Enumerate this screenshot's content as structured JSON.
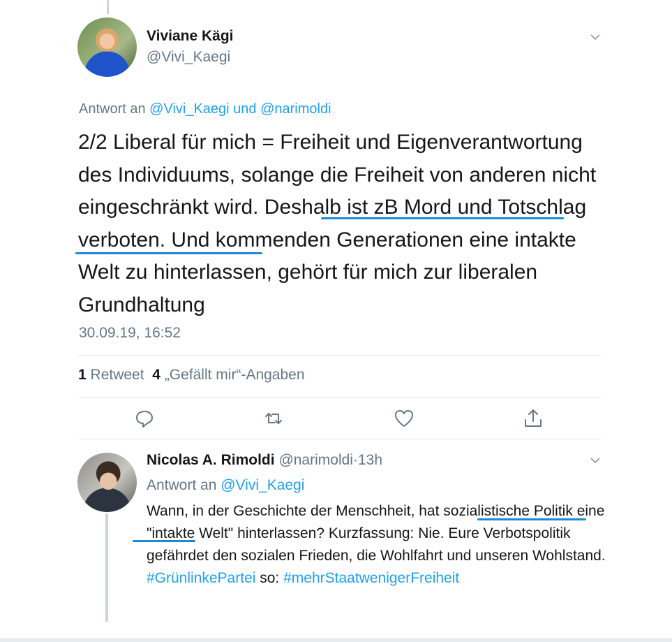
{
  "tweet": {
    "author_name": "Viviane Kägi",
    "author_handle": "@Vivi_Kaegi",
    "reply_prefix": "Antwort an ",
    "reply_handles": "@Vivi_Kaegi und @narimoldi",
    "text_before": "2/2 Liberal für mich = Freiheit und Eigenverantwortung des Individuums, solange die Freiheit von anderen nicht eingeschränkt wird. ",
    "text_highlighted": "Deshalb ist zB Mord und Totschlag verboten.",
    "text_after": " Und kommenden Generationen eine intakte Welt zu hinterlassen, gehört für mich zur liberalen Grundhaltung",
    "timestamp": "30.09.19, 16:52"
  },
  "stats": {
    "retweet_count": "1",
    "retweet_label": "Retweet",
    "like_count": "4",
    "like_label": "„Gefällt mir“-Angaben"
  },
  "actions": {
    "reply_icon": "reply-icon",
    "retweet_icon": "retweet-icon",
    "like_icon": "heart-icon",
    "share_icon": "share-icon"
  },
  "reply": {
    "author_name": "Nicolas A. Rimoldi",
    "author_handle": "@narimoldi",
    "separator": "·",
    "age": "13h",
    "reply_prefix": "Antwort an ",
    "reply_handle": "@Vivi_Kaegi",
    "text_1": "Wann, in der Geschichte der Menschheit, hat ",
    "text_highlighted": "sozialistische Politik",
    "text_2": " eine \"intakte Welt\" hinterlassen? Kurzfassung: Nie. Eure Verbotspolitik gefährdet den sozialen Frieden, die Wohlfahrt und unseren Wohlstand. ",
    "hashtag_1": "#GrünlinkePartei",
    "text_3": " so: ",
    "hashtag_2": "#mehrStaatwenigerFreiheit"
  },
  "colors": {
    "link": "#1da1f2",
    "secondary_text": "#657786",
    "annotation_underline": "#1a8ad6"
  }
}
